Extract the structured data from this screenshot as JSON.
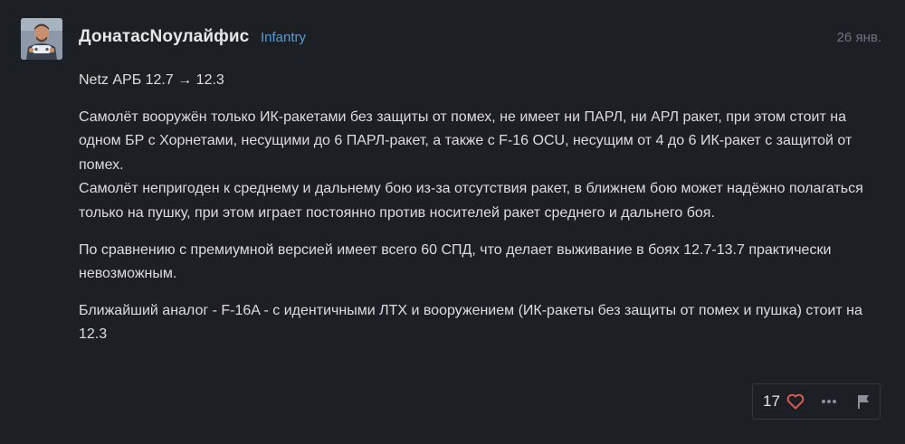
{
  "post": {
    "author": {
      "name": "ДонатасNoулайфис",
      "title": "Infantry",
      "avatar_icon": "avatar-gamer-icon"
    },
    "date": "26 янв.",
    "body": {
      "line1": "Netz АРБ 12.7 → 12.3",
      "para2_a": "Самолёт вооружён только ИК-ракетами без защиты от помех, не имеет ни ПАРЛ, ни АРЛ ракет, при этом стоит на одном БР с Хорнетами, несущими до 6 ПАРЛ-ракет, а также с F-16 OCU, несущим от 4 до 6 ИК-ракет с защитой от помех.",
      "para2_b": "Самолёт непригоден к среднему и дальнему бою из-за отсутствия ракет, в ближнем бою может надёжно полагаться только на пушку, при этом играет постоянно против носителей ракет среднего и дальнего боя.",
      "para3": "По сравнению с премиумной версией имеет всего 60 СПД, что делает выживание в боях 12.7-13.7 практически невозможным.",
      "para4": "Ближайший аналог - F-16A - с идентичными ЛТХ и вооружением (ИК-ракеты без защиты от помех и пушка) стоит на 12.3"
    },
    "actions": {
      "like_count": "17",
      "like_icon": "heart-icon",
      "more_icon": "more-dots-icon",
      "report_icon": "flag-icon"
    }
  },
  "colors": {
    "background": "#1c1f24",
    "text": "#dcdddf",
    "user_title": "#5b9ad3",
    "date": "#6f747c",
    "heart": "#e0574f"
  }
}
